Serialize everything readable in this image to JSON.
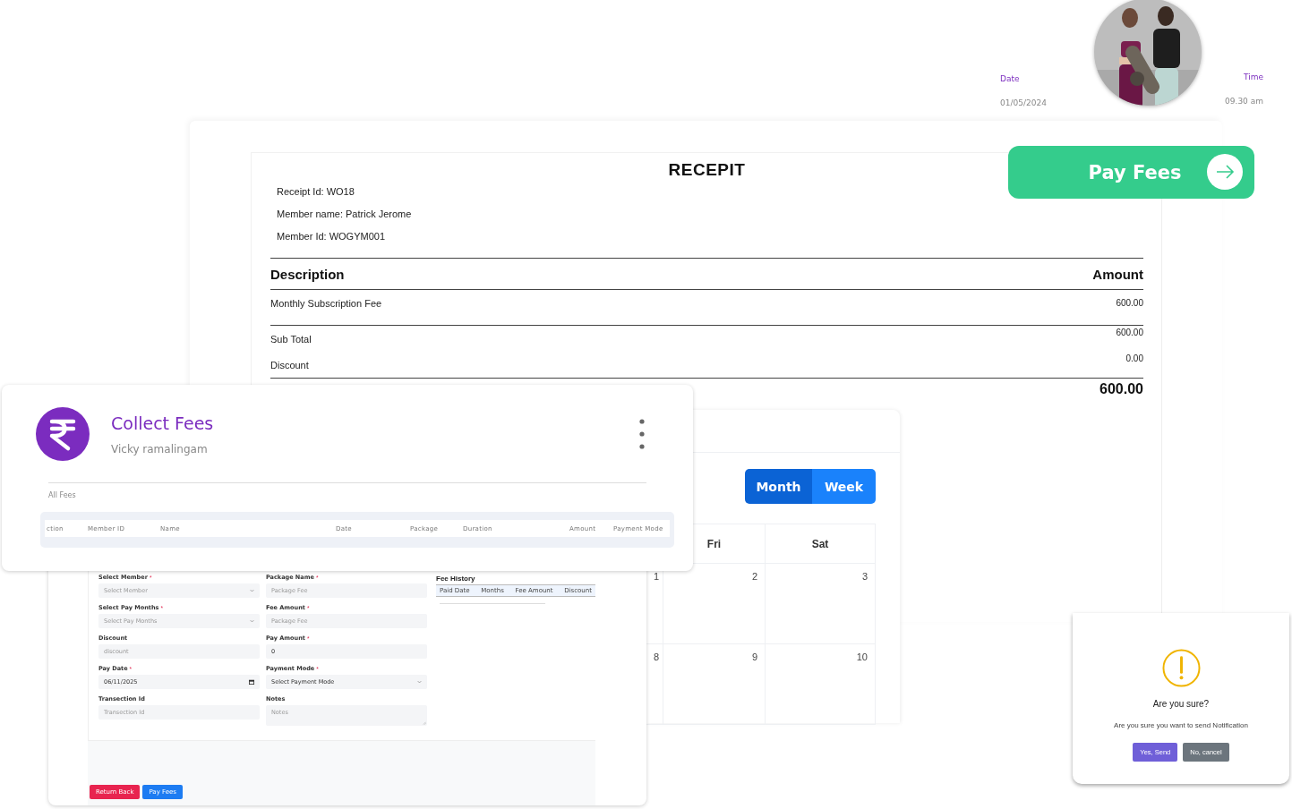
{
  "receipt": {
    "title": "RECEPIT",
    "details": [
      "Receipt Id: WO18",
      "Member name: Patrick Jerome",
      "Member Id: WOGYM001"
    ],
    "columns": [
      "Description",
      "Amount"
    ],
    "items": [
      {
        "description": "Monthly Subscription Fee",
        "amount": "600.00"
      }
    ],
    "summary": [
      {
        "label": "Sub Total",
        "value": "600.00"
      },
      {
        "label": "Discount",
        "value": "0.00"
      }
    ],
    "total": "600.00"
  },
  "profile": {
    "kind": "picture",
    "date_label": "Date",
    "date": "01/05/2024",
    "time_label": "Time",
    "time": "09.30 am"
  },
  "pay_button": {
    "label": "Pay Fees"
  },
  "calendar": {
    "views": [
      {
        "label": "Month",
        "selected": true
      },
      {
        "label": "Week",
        "selected": false
      }
    ],
    "days": [
      "Fri",
      "Sat"
    ],
    "weeks": [
      [
        "1",
        "2",
        "3"
      ],
      [
        "8",
        "9",
        "10"
      ]
    ]
  },
  "collect_fees": {
    "title": "Collect Fees",
    "member": "Vicky ramalingam",
    "section": "All Fees",
    "columns": [
      "ction",
      "Member ID",
      "Name",
      "Date",
      "Package",
      "Duration",
      "Amount",
      "Payment Mode"
    ]
  },
  "form": {
    "fields": [
      {
        "label": "Select Member",
        "required_mark": "*",
        "kind": "select",
        "placeholder": "Select Member"
      },
      {
        "label": "Package Name",
        "required_mark": "*",
        "kind": "input",
        "placeholder": "Package Fee"
      },
      {
        "label": "Select Pay Months",
        "required_mark": "*",
        "kind": "select",
        "placeholder": "Select Pay Months"
      },
      {
        "label": "Fee Amount",
        "required_mark": "*",
        "kind": "input",
        "placeholder": "Package Fee"
      },
      {
        "label": "Discount",
        "kind": "input",
        "placeholder": "discount"
      },
      {
        "label": "Pay Amount",
        "required_mark": "*",
        "kind": "input",
        "value": "0"
      },
      {
        "label": "Pay Date",
        "required_mark": "*",
        "kind": "date",
        "value": "06/11/2025"
      },
      {
        "label": "Payment Mode",
        "required_mark": "*",
        "kind": "select",
        "value": "Select Payment Mode"
      },
      {
        "label": "Transection Id",
        "kind": "input",
        "placeholder": "Transection Id"
      },
      {
        "label": "Notes",
        "kind": "textarea",
        "placeholder": "Notes"
      }
    ],
    "fee_history": {
      "title": "Fee History",
      "columns": [
        "Paid Date",
        "Months",
        "Fee Amount",
        "Discount"
      ]
    },
    "buttons": [
      {
        "label": "Return Back",
        "kind": "danger"
      },
      {
        "label": "Pay Fees",
        "kind": "primary"
      }
    ]
  },
  "dialog": {
    "title": "Are you sure?",
    "message": "Are you sure you want to send Notification",
    "buttons": [
      {
        "label": "Yes, Send",
        "kind": "confirm"
      },
      {
        "label": "No, cancel",
        "kind": "cancel"
      }
    ]
  }
}
